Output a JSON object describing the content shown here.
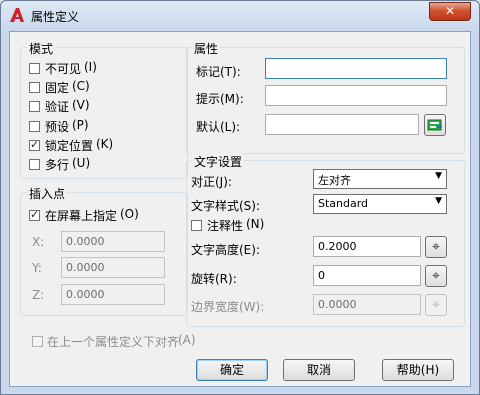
{
  "window": {
    "title": "属性定义",
    "close_label": "✕"
  },
  "mode": {
    "title": "模式",
    "options": [
      {
        "label": "不可见",
        "key": "(I)",
        "checked": false
      },
      {
        "label": "固定",
        "key": "(C)",
        "checked": false
      },
      {
        "label": "验证",
        "key": "(V)",
        "checked": false
      },
      {
        "label": "预设",
        "key": "(P)",
        "checked": false
      },
      {
        "label": "锁定位置",
        "key": "(K)",
        "checked": true
      },
      {
        "label": "多行",
        "key": "(U)",
        "checked": false
      }
    ]
  },
  "insertion": {
    "title": "插入点",
    "on_screen_label": "在屏幕上指定",
    "on_screen_key": "(O)",
    "x_label": "X:",
    "x_value": "0.0000",
    "y_label": "Y:",
    "y_value": "0.0000",
    "z_label": "Z:",
    "z_value": "0.0000"
  },
  "attribute": {
    "title": "属性",
    "tag_label": "标记(T):",
    "tag_value": "",
    "prompt_label": "提示(M):",
    "prompt_value": "",
    "default_label": "默认(L):",
    "default_value": ""
  },
  "text": {
    "title": "文字设置",
    "justify_label": "对正(J):",
    "justify_value": "左对齐",
    "style_label": "文字样式(S):",
    "style_value": "Standard",
    "annotative_label": "注释性",
    "annotative_key": "(N)",
    "height_label": "文字高度(E):",
    "height_value": "0.2000",
    "rotation_label": "旋转(R):",
    "rotation_value": "0",
    "boundary_label": "边界宽度(W):",
    "boundary_value": "0.0000"
  },
  "align_below": {
    "label": "在上一个属性定义下对齐",
    "key": "(A)"
  },
  "buttons": {
    "ok": "确定",
    "cancel": "取消",
    "help": "帮助(H)"
  }
}
